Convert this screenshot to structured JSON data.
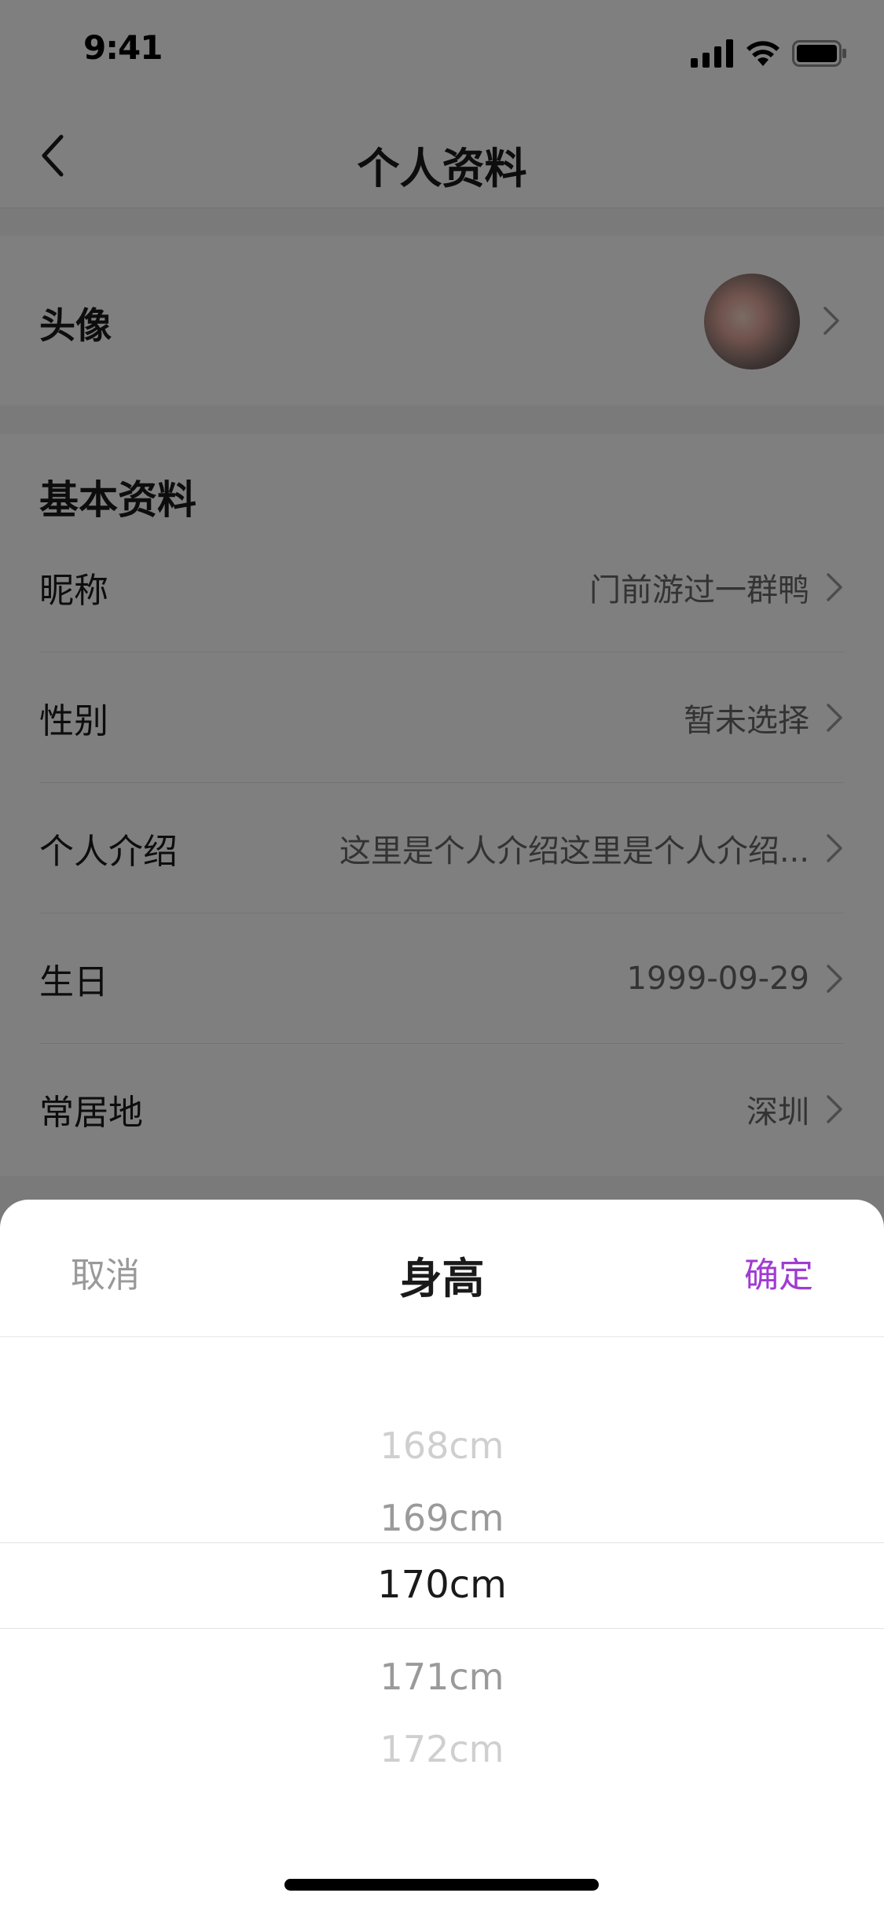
{
  "status_bar": {
    "time": "9:41"
  },
  "nav": {
    "title": "个人资料"
  },
  "avatar_row": {
    "label": "头像"
  },
  "basic_info": {
    "section_title": "基本资料",
    "rows": [
      {
        "label": "昵称",
        "value": "门前游过一群鸭"
      },
      {
        "label": "性别",
        "value": "暂未选择"
      },
      {
        "label": "个人介绍",
        "value": "这里是个人介绍这里是个人介绍..."
      },
      {
        "label": "生日",
        "value": "1999-09-29"
      },
      {
        "label": "常居地",
        "value": "深圳"
      }
    ]
  },
  "picker": {
    "cancel_label": "取消",
    "title": "身高",
    "confirm_label": "确定",
    "options": [
      "168cm",
      "169cm",
      "170cm",
      "171cm",
      "172cm"
    ],
    "selected": "170cm",
    "accent_color": "#a03bd2"
  },
  "icons": {
    "back": "chevron-left-icon",
    "row_arrow": "chevron-right-icon",
    "signal": "cellular-signal-icon",
    "wifi": "wifi-icon",
    "battery": "battery-icon"
  }
}
